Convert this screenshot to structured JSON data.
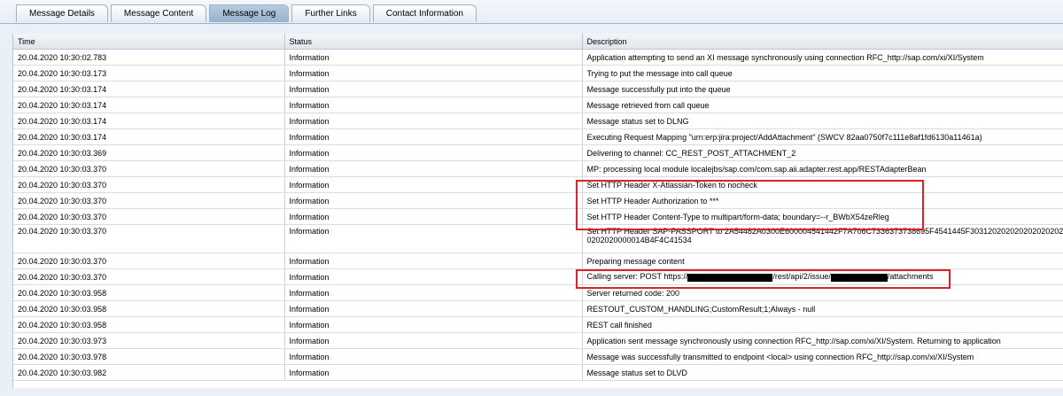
{
  "tabs": [
    {
      "label": "Message Details",
      "active": false
    },
    {
      "label": "Message Content",
      "active": false
    },
    {
      "label": "Message Log",
      "active": true
    },
    {
      "label": "Further Links",
      "active": false
    },
    {
      "label": "Contact Information",
      "active": false
    }
  ],
  "columns": {
    "time": "Time",
    "status": "Status",
    "description": "Description"
  },
  "rows": [
    {
      "time": "20.04.2020 10:30:02.783",
      "status": "Information",
      "description": "Application attempting to send an XI message synchronously using connection RFC_http://sap.com/xi/XI/System"
    },
    {
      "time": "20.04.2020 10:30:03.173",
      "status": "Information",
      "description": "Trying to put the message into call queue"
    },
    {
      "time": "20.04.2020 10:30:03.174",
      "status": "Information",
      "description": "Message successfully put into the queue"
    },
    {
      "time": "20.04.2020 10:30:03.174",
      "status": "Information",
      "description": "Message retrieved from call queue"
    },
    {
      "time": "20.04.2020 10:30:03.174",
      "status": "Information",
      "description": "Message status set to DLNG"
    },
    {
      "time": "20.04.2020 10:30:03.174",
      "status": "Information",
      "description": "Executing Request Mapping \"urn:erp:jira:project/AddAttachment\" (SWCV 82aa0750f7c111e8af1fd6130a11461a)"
    },
    {
      "time": "20.04.2020 10:30:03.369",
      "status": "Information",
      "description": "Delivering to channel: CC_REST_POST_ATTACHMENT_2"
    },
    {
      "time": "20.04.2020 10:30:03.370",
      "status": "Information",
      "description": "MP: processing local module localejbs/sap.com/com.sap.aii.adapter.rest.app/RESTAdapterBean"
    },
    {
      "time": "20.04.2020 10:30:03.370",
      "status": "Information",
      "description": "Set HTTP Header X-Atlassian-Token to nocheck"
    },
    {
      "time": "20.04.2020 10:30:03.370",
      "status": "Information",
      "description": "Set HTTP Header Authorization to ***"
    },
    {
      "time": "20.04.2020 10:30:03.370",
      "status": "Information",
      "description": "Set HTTP Header Content-Type to multipart/form-data; boundary=--r_BWbX54zeRleg"
    },
    {
      "time": "20.04.2020 10:30:03.370",
      "status": "Information",
      "description": "Set HTTP Header SAP-PASSPORT to 2A54482A0300E600004541442F7A706C7336373738695F4541445F3031202020202020202020202020000014B4F4C41534"
    },
    {
      "time": "20.04.2020 10:30:03.370",
      "status": "Information",
      "description": "Preparing message content"
    },
    {
      "time": "20.04.2020 10:30:03.370",
      "status": "Information",
      "description_parts": [
        "Calling server: POST https://",
        "/rest/api/2/issue/",
        "/attachments"
      ]
    },
    {
      "time": "20.04.2020 10:30:03.958",
      "status": "Information",
      "description": "Server returned code: 200"
    },
    {
      "time": "20.04.2020 10:30:03.958",
      "status": "Information",
      "description": "RESTOUT_CUSTOM_HANDLING;CustomResult;1;Always - null"
    },
    {
      "time": "20.04.2020 10:30:03.958",
      "status": "Information",
      "description": "REST call finished"
    },
    {
      "time": "20.04.2020 10:30:03.973",
      "status": "Information",
      "description": "Application sent message synchronously using connection RFC_http://sap.com/xi/XI/System. Returning to application"
    },
    {
      "time": "20.04.2020 10:30:03.978",
      "status": "Information",
      "description": "Message was successfully transmitted to endpoint <local> using connection RFC_http://sap.com/xi/XI/System"
    },
    {
      "time": "20.04.2020 10:30:03.982",
      "status": "Information",
      "description": "Message status set to DLVD"
    }
  ],
  "colors": {
    "highlight": "#e0202a",
    "active_tab": "#a7bfd7",
    "header_bg": "#e6ebf0"
  }
}
